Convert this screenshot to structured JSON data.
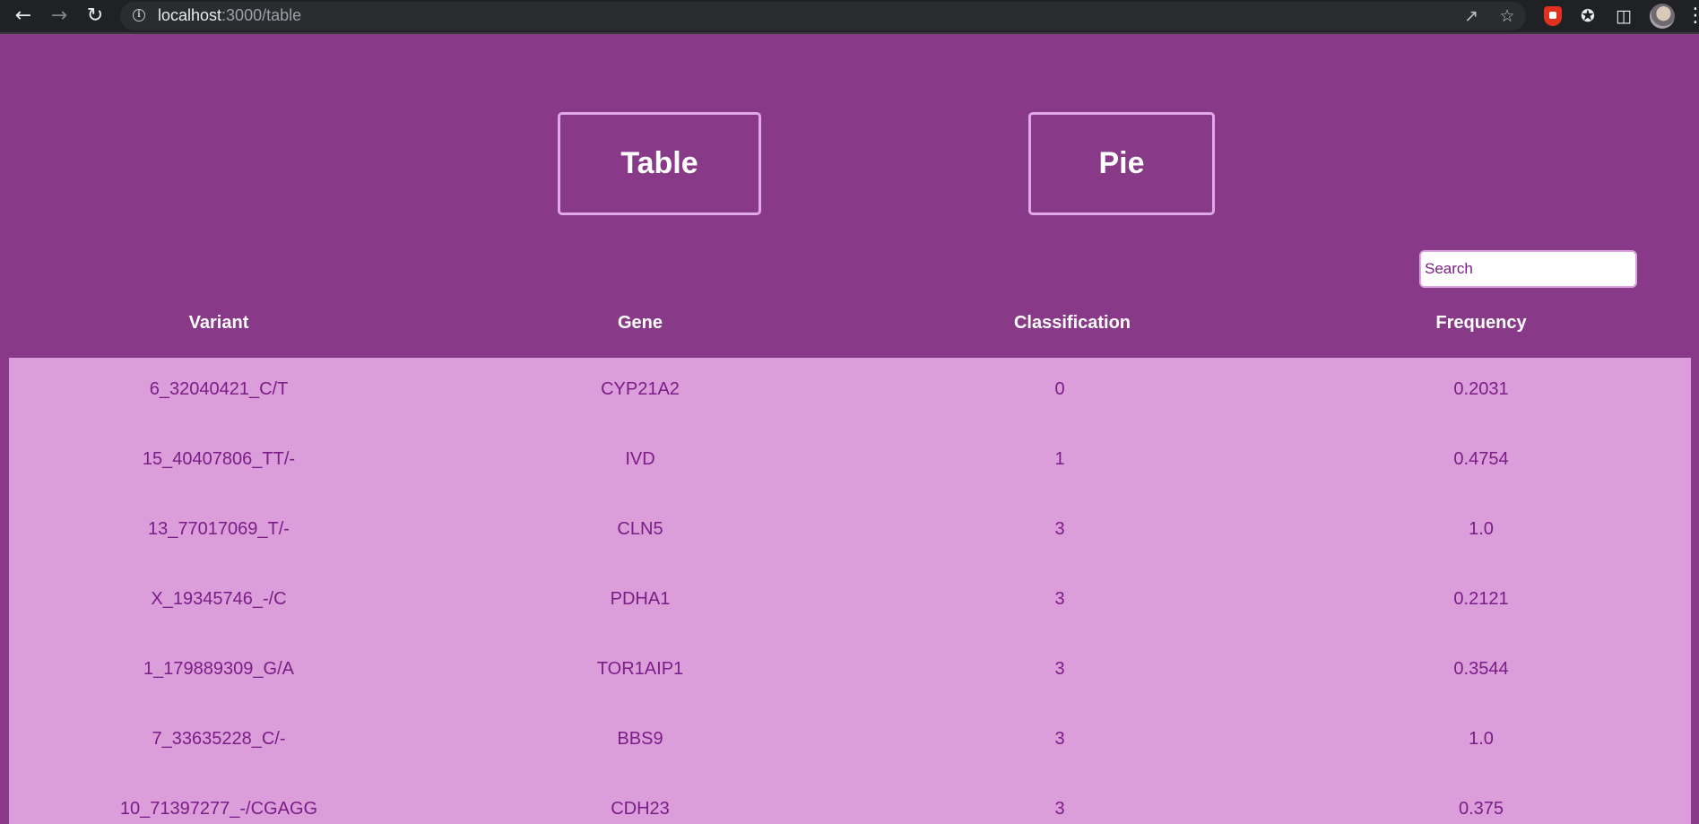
{
  "browser": {
    "url_host": "localhost",
    "url_path": ":3000/table"
  },
  "nav": {
    "table_label": "Table",
    "pie_label": "Pie"
  },
  "search": {
    "placeholder": "Search"
  },
  "table": {
    "columns": [
      "Variant",
      "Gene",
      "Classification",
      "Frequency"
    ],
    "rows": [
      [
        "6_32040421_C/T",
        "CYP21A2",
        "0",
        "0.2031"
      ],
      [
        "15_40407806_TT/-",
        "IVD",
        "1",
        "0.4754"
      ],
      [
        "13_77017069_T/-",
        "CLN5",
        "3",
        "1.0"
      ],
      [
        "X_19345746_-/C",
        "PDHA1",
        "3",
        "0.2121"
      ],
      [
        "1_179889309_G/A",
        "TOR1AIP1",
        "3",
        "0.3544"
      ],
      [
        "7_33635228_C/-",
        "BBS9",
        "3",
        "1.0"
      ],
      [
        "10_71397277_-/CGAGG",
        "CDH23",
        "3",
        "0.375"
      ]
    ]
  },
  "colors": {
    "page_background": "#883a88",
    "table_body": "#dc9edb",
    "cell_text": "#7a1d86",
    "nav_border": "#e1a7e6"
  }
}
